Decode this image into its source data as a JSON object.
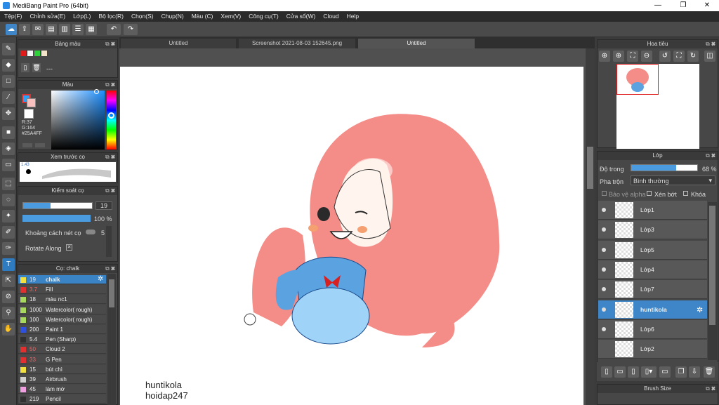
{
  "window": {
    "title": "MediBang Paint Pro (64bit)",
    "minimize": "—",
    "maximize": "❐",
    "close": "✕"
  },
  "menu": [
    "Tệp(F)",
    "Chỉnh sửa(E)",
    "Lớp(L)",
    "Bộ lọc(R)",
    "Chọn(S)",
    "Chụp(N)",
    "Màu (C)",
    "Xem(V)",
    "Công cụ(T)",
    "Cửa sổ(W)",
    "Cloud",
    "Help"
  ],
  "tabs": [
    "Untitled",
    "Screenshot 2021-08-03 152645.png",
    "Untitled"
  ],
  "palette": {
    "title": "Bảng màu",
    "swatches": [
      "#e11a1a",
      "#f5f5f5",
      "#2fd13a",
      "#f1e4c8"
    ],
    "dash": "---"
  },
  "color": {
    "title": "Màu",
    "r": "R:37",
    "g": "G:164",
    "hex": "#25A4FF",
    "main_color": "#25a4ff"
  },
  "brush_preview": {
    "title": "Xem trước cọ",
    "size": "1.43"
  },
  "brush_control": {
    "title": "Kiểm soát cọ",
    "size_value": "19",
    "opacity_value": "100 %",
    "spacing_label": "Khoảng cách nét cọ",
    "spacing_value": "5",
    "rotate_label": "Rotate Along"
  },
  "brushes": {
    "title": "Cọ: chalk",
    "items": [
      {
        "size": "19",
        "name": "chalk",
        "color": "#f0e040"
      },
      {
        "size": "3.7",
        "name": "Fill",
        "color": "#e03030"
      },
      {
        "size": "18",
        "name": "màu nc1",
        "color": "#a8d860"
      },
      {
        "size": "1000",
        "name": "Watercolor( rough)",
        "color": "#a8d860"
      },
      {
        "size": "100",
        "name": "Watercolor( rough)",
        "color": "#a8d860"
      },
      {
        "size": "200",
        "name": "Paint 1",
        "color": "#3050e0"
      },
      {
        "size": "5.4",
        "name": "Pen (Sharp)",
        "color": "#303030"
      },
      {
        "size": "50",
        "name": "Cloud 2",
        "color": "#e03030"
      },
      {
        "size": "33",
        "name": "G Pen",
        "color": "#e03030"
      },
      {
        "size": "15",
        "name": "bút chì",
        "color": "#f0e040"
      },
      {
        "size": "39",
        "name": "Airbrush",
        "color": "#d0d0d0"
      },
      {
        "size": "45",
        "name": "làm mờ",
        "color": "#f0a0e0"
      },
      {
        "size": "219",
        "name": "Pencil",
        "color": "#303030"
      }
    ]
  },
  "canvas": {
    "watermark_line1": "huntikola",
    "watermark_line2": "hoidap247"
  },
  "navigator": {
    "title": "Hoa tiêu"
  },
  "layers": {
    "title": "Lớp",
    "opacity_label": "Độ trong",
    "opacity_value": "68 %",
    "opacity_fraction": 0.68,
    "blend_label": "Pha trộn",
    "blend_value": "Bình thường",
    "protect_alpha": "Bảo vệ alpha",
    "clipping": "Xén bớt",
    "lock": "Khóa",
    "items": [
      "Lớp1",
      "Lớp3",
      "Lớp5",
      "Lớp4",
      "Lớp7",
      "huntikola",
      "Lớp6",
      "Lớp2"
    ]
  },
  "brush_size_panel": {
    "title": "Brush Size"
  }
}
